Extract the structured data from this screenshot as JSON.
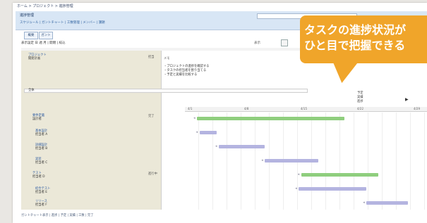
{
  "breadcrumb": "ホーム > プロジェクト > 進捗管理",
  "title_bar": {
    "title": "進捗管理",
    "links": "スケジュール | ガントチャート | 工数管理 | メンバー | 課題"
  },
  "tabs": [
    "概要",
    "ガント"
  ],
  "toolbar": {
    "left": "表示設定 日 週 月 | 開閉 | 絞込",
    "zoom_label": "表示"
  },
  "tasks": [
    {
      "name": "プロジェクト",
      "sub": "開発計画",
      "tag": "担当"
    },
    {
      "name": "要件定義",
      "sub": "設計者",
      "tag": "完了"
    },
    {
      "name": "基本設計",
      "sub": "担当者 A",
      "tag": ""
    },
    {
      "name": "詳細設計",
      "sub": "担当者 B",
      "tag": ""
    },
    {
      "name": "実装",
      "sub": "担当者 C",
      "tag": ""
    },
    {
      "name": "テスト",
      "sub": "担当者 D",
      "tag": "進行中"
    },
    {
      "name": "結合テスト",
      "sub": "担当者 E",
      "tag": ""
    },
    {
      "name": "リリース",
      "sub": "担当者 F",
      "tag": ""
    }
  ],
  "memo_label": "メモ",
  "notes": "・プロジェクトの進捗を確認する\n・タスクの担当者を割り当てる\n・予定と実績を比較する",
  "wide_field_label": "全体",
  "legend": [
    "予定",
    "実績",
    "進捗"
  ],
  "scale_labels": [
    "4/1",
    "4/8",
    "4/15",
    "4/22",
    "4/29"
  ],
  "bars": [
    {
      "task": "要件定義",
      "color": "green",
      "start": 0.05,
      "end": 0.66
    },
    {
      "task": "基本設計",
      "color": "lav",
      "start": 0.06,
      "end": 0.13
    },
    {
      "task": "詳細設計",
      "color": "lav",
      "start": 0.14,
      "end": 0.33
    },
    {
      "task": "実装",
      "color": "lav",
      "start": 0.33,
      "end": 0.55
    },
    {
      "task": "テスト",
      "color": "green",
      "start": 0.48,
      "end": 0.8
    },
    {
      "task": "結合テスト",
      "color": "lav",
      "start": 0.47,
      "end": 0.75
    },
    {
      "task": "リリース",
      "color": "lav",
      "start": 0.75,
      "end": 0.92
    }
  ],
  "footer": "ガントチャート表示 | 進捗 | 予定 | 実績 | 工数 | 完了",
  "callout": {
    "line1": "タスクの進捗状況が",
    "line2": "ひと目で把握できる"
  },
  "colors": {
    "green": "#8fce7e",
    "lav": "#b4b4e0",
    "callout": "#f0a52a"
  }
}
